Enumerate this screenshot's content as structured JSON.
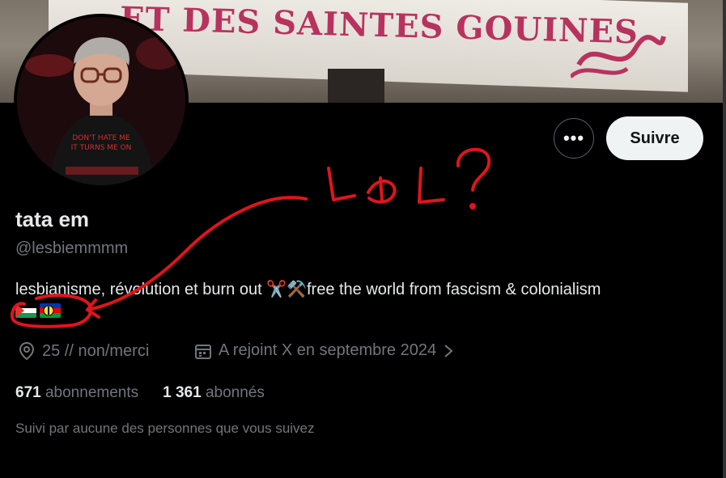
{
  "banner": {
    "text": "ET DES SAINTES GOUINES"
  },
  "profile": {
    "display_name": "tata em",
    "handle": "@lesbiemmmm",
    "bio": "lesbianisme, révolution et burn out ✂️⚒️free the world from fascism & colonialism",
    "flags": [
      "palestine-flag",
      "kanaky-flag"
    ],
    "location": "25 // non/merci",
    "joined": "A rejoint X en septembre 2024",
    "following_count": "671",
    "following_label": "abonnements",
    "followers_count": "1 361",
    "followers_label": "abonnés",
    "followed_by": "Suivi par aucune des personnes que vous suivez",
    "avatar_shirt_text": "DON'T HATE ME IT TURNS ME ON"
  },
  "actions": {
    "more_label": "•••",
    "follow_label": "Suivre"
  },
  "annotation": {
    "text": "LDL ?",
    "color": "#e0141c"
  },
  "colors": {
    "background": "#000000",
    "text": "#e7e9ea",
    "muted": "#71767b",
    "banner_text": "#b8325f"
  }
}
